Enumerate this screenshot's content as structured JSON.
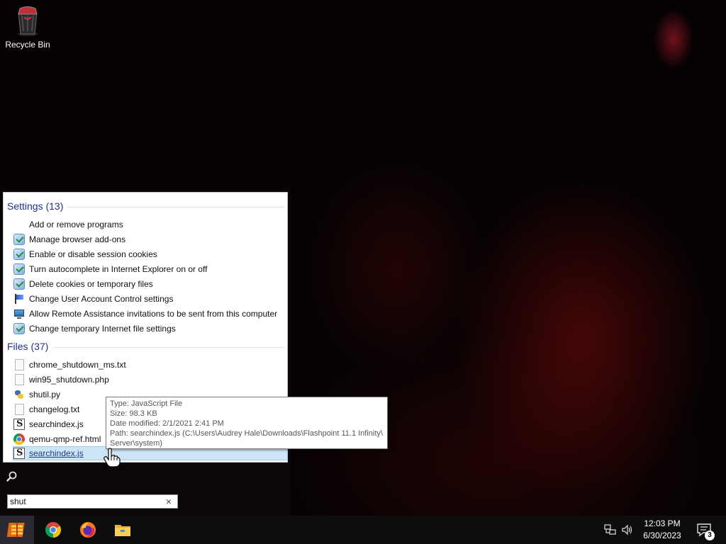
{
  "desktop": {
    "recycle_bin_label": "Recycle Bin"
  },
  "start_menu": {
    "settings_header": "Settings (13)",
    "settings": [
      {
        "label": "Add or remove programs",
        "icon": "none"
      },
      {
        "label": "Manage browser add-ons",
        "icon": "control-panel-icon"
      },
      {
        "label": "Enable or disable session cookies",
        "icon": "control-panel-icon"
      },
      {
        "label": "Turn autocomplete in Internet Explorer on or off",
        "icon": "control-panel-icon"
      },
      {
        "label": "Delete cookies or temporary files",
        "icon": "control-panel-icon"
      },
      {
        "label": "Change User Account Control settings",
        "icon": "uac-flag-icon"
      },
      {
        "label": "Allow Remote Assistance invitations to be sent from this computer",
        "icon": "monitor-icon"
      },
      {
        "label": "Change temporary Internet file settings",
        "icon": "control-panel-icon"
      }
    ],
    "files_header": "Files (37)",
    "files": [
      {
        "label": "chrome_shutdown_ms.txt",
        "icon": "text-file-icon"
      },
      {
        "label": "win95_shutdown.php",
        "icon": "text-file-icon"
      },
      {
        "label": "shutil.py",
        "icon": "python-file-icon"
      },
      {
        "label": "changelog.txt",
        "icon": "text-file-icon"
      },
      {
        "label": "searchindex.js",
        "icon": "js-file-icon"
      },
      {
        "label": "qemu-qmp-ref.html",
        "icon": "chrome-file-icon"
      },
      {
        "label": "searchindex.js",
        "icon": "js-file-icon",
        "selected": true
      }
    ],
    "tooltip": {
      "type": "Type: JavaScript File",
      "size": "Size: 98.3 KB",
      "modified": "Date modified: 2/1/2021 2:41 PM",
      "path_line1": "Path: searchindex.js (C:\\Users\\Audrey Hale\\Downloads\\Flashpoint 11.1 Infinity\\",
      "path_line2": "Server\\system)"
    },
    "search": {
      "value": "shut",
      "clear_glyph": "×"
    }
  },
  "taskbar": {
    "pinned": [
      "start-logo-icon",
      "chrome-icon",
      "firefox-icon",
      "file-explorer-icon"
    ],
    "clock_time": "12:03 PM",
    "clock_date": "6/30/2023",
    "notification_count": "3"
  },
  "colors": {
    "section_header": "#1e3287",
    "selection_bg": "#cde6f7",
    "taskbar_bg": "#0d0d10"
  }
}
